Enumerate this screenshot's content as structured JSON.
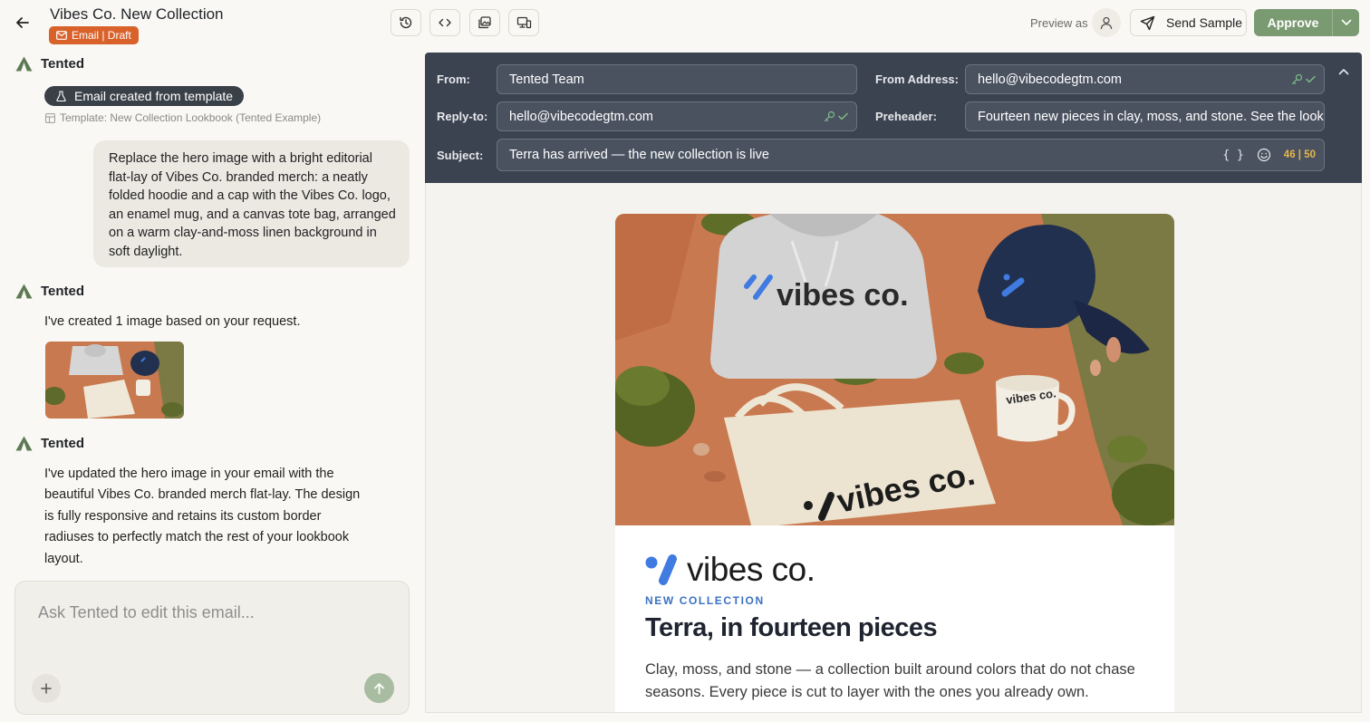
{
  "header": {
    "title": "Vibes Co. New Collection",
    "status": "Email | Draft",
    "preview_as_label": "Preview as",
    "send_sample_label": "Send Sample",
    "approve_label": "Approve"
  },
  "chat": {
    "assistant_name": "Tented",
    "template_chip": "Email created from template",
    "template_ref": "Template: New Collection Lookbook (Tented Example)",
    "user_message": "Replace the hero image with a bright editorial flat-lay of Vibes Co. branded merch: a neatly folded hoodie and a cap with the Vibes Co. logo, an enamel mug, and a canvas tote bag, arranged on a warm clay-and-moss linen background in soft daylight.",
    "reply_1": "I've created 1 image based on your request.",
    "reply_2": "I've updated the hero image in your email with the beautiful Vibes Co. branded merch flat-lay. The design is fully responsive and retains its custom border radiuses to perfectly match the rest of your lookbook layout.",
    "composer_placeholder": "Ask Tented to edit this email..."
  },
  "form": {
    "from_label": "From:",
    "from_value": "Tented Team",
    "from_address_label": "From Address:",
    "from_address_value": "hello@vibecodegtm.com",
    "reply_to_label": "Reply-to:",
    "reply_to_value": "hello@vibecodegtm.com",
    "preheader_label": "Preheader:",
    "preheader_value": "Fourteen new pieces in clay, moss, and stone. See the lookbook.",
    "subject_label": "Subject:",
    "subject_value": "Terra has arrived — the new collection is live",
    "merge_tag_symbol": "{ }",
    "char_count": "46 | 50"
  },
  "email": {
    "hero_text_hoodie": "vibes co.",
    "hero_text_tote": "vibes co.",
    "hero_text_mug": "vibes co.",
    "brand_wordmark": "vibes co.",
    "eyebrow": "NEW COLLECTION",
    "headline": "Terra, in fourteen pieces",
    "body": "Clay, moss, and stone — a collection built around colors that do not chase seasons. Every piece is cut to layer with the ones you already own."
  },
  "colors": {
    "accent_green": "#7a9a72",
    "status_orange": "#d9622b",
    "header_slate": "#3b4350",
    "brand_blue": "#3c72c3",
    "clay": "#c9794f",
    "moss": "#7b7a44"
  }
}
